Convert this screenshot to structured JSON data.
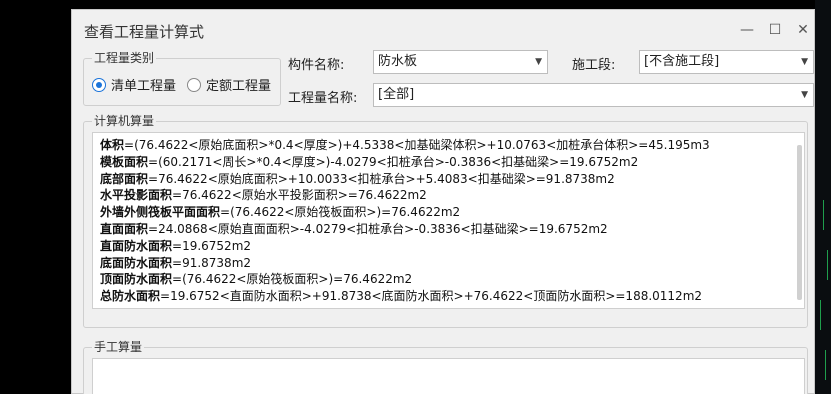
{
  "dialog": {
    "title": "查看工程量计算式",
    "min_icon": "minimize-icon",
    "max_icon": "maximize-icon",
    "close_icon": "close-icon"
  },
  "category": {
    "label": "工程量类别",
    "options": [
      {
        "label": "清单工程量",
        "checked": true
      },
      {
        "label": "定额工程量",
        "checked": false
      }
    ]
  },
  "component": {
    "label": "构件名称:",
    "value": "防水板"
  },
  "stage": {
    "label": "施工段:",
    "value": "[不含施工段]"
  },
  "quantity_name": {
    "label": "工程量名称:",
    "value": "[全部]"
  },
  "computed": {
    "label": "计算机算量",
    "lines": [
      {
        "name": "体积",
        "formula": "=(76.4622<原始底面积>*0.4<厚度>)+4.5338<加基础梁体积>+10.0763<加桩承台体积>=45.195m3"
      },
      {
        "name": "模板面积",
        "formula": "=(60.2171<周长>*0.4<厚度>)-4.0279<扣桩承台>-0.3836<扣基础梁>=19.6752m2"
      },
      {
        "name": "底部面积",
        "formula": "=76.4622<原始底面积>+10.0033<扣桩承台>+5.4083<扣基础梁>=91.8738m2"
      },
      {
        "name": "水平投影面积",
        "formula": "=76.4622<原始水平投影面积>=76.4622m2"
      },
      {
        "name": "外墙外侧筏板平面面积",
        "formula": "=(76.4622<原始筏板面积>)=76.4622m2"
      },
      {
        "name": "直面面积",
        "formula": "=24.0868<原始直面面积>-4.0279<扣桩承台>-0.3836<扣基础梁>=19.6752m2"
      },
      {
        "name": "直面防水面积",
        "formula": "=19.6752m2"
      },
      {
        "name": "底面防水面积",
        "formula": "=91.8738m2"
      },
      {
        "name": "顶面防水面积",
        "formula": "=(76.4622<原始筏板面积>)=76.4622m2"
      },
      {
        "name": "总防水面积",
        "formula": "=19.6752<直面防水面积>+91.8738<底面防水面积>+76.4622<顶面防水面积>=188.0112m2"
      }
    ]
  },
  "manual": {
    "label": "手工算量"
  }
}
